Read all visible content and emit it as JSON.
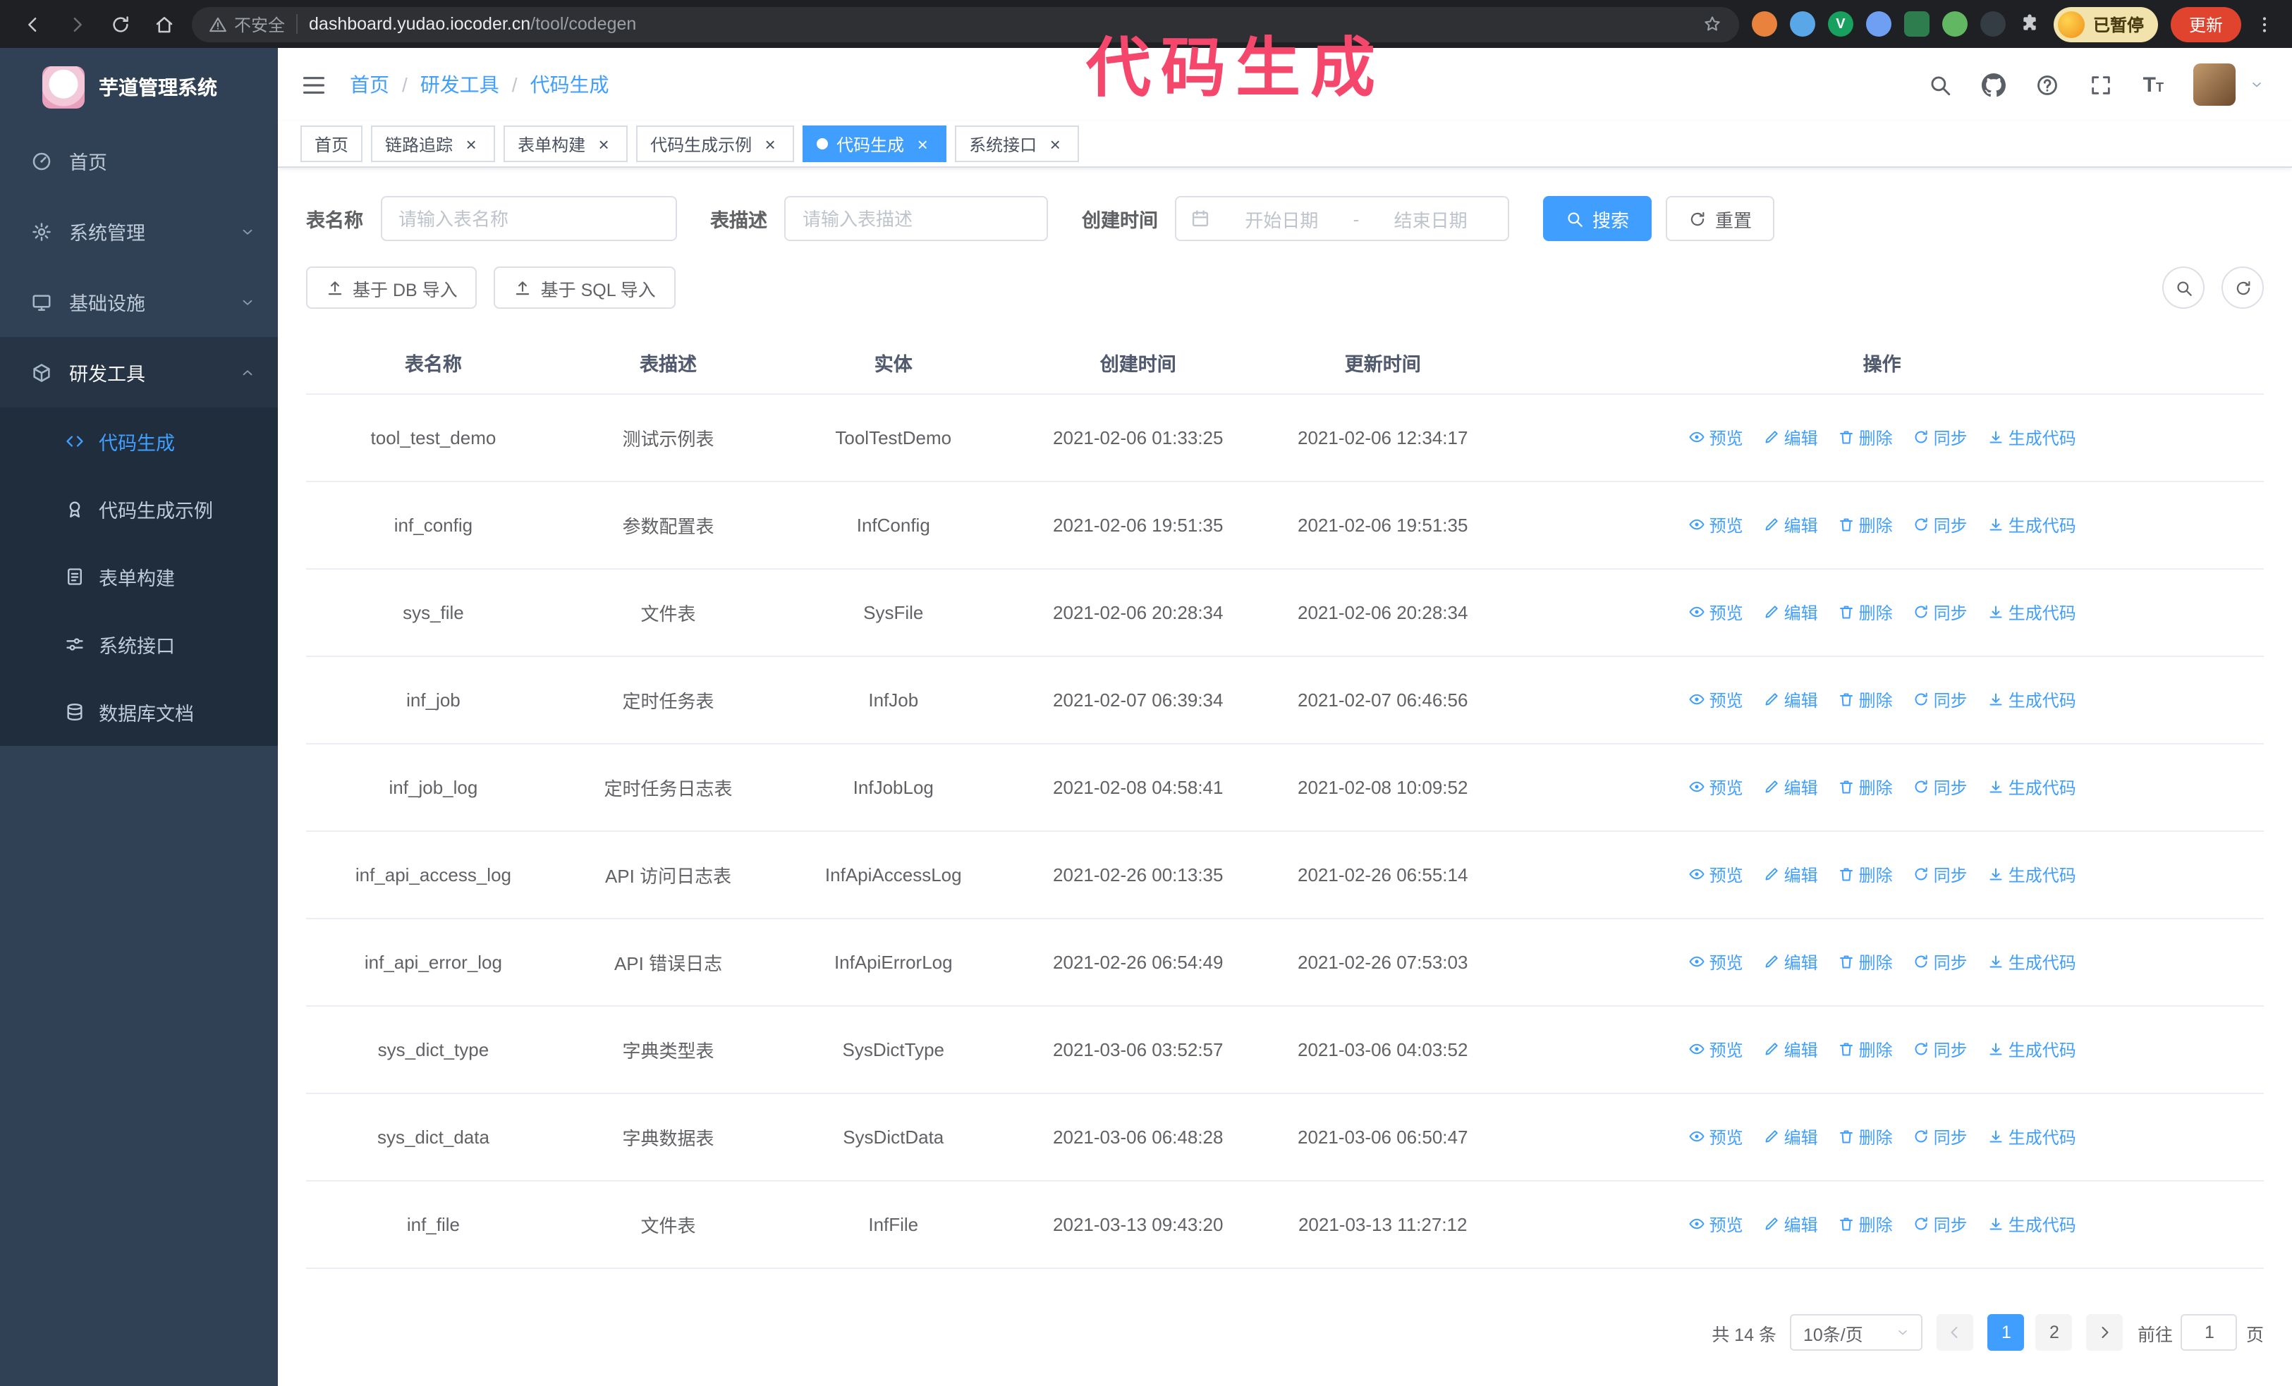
{
  "annotation": {
    "text": "代码生成",
    "color": "#f5476b"
  },
  "theme": {
    "primary": "#409eff",
    "sidebar_bg": "#304156",
    "submenu_bg": "#1f2d3d"
  },
  "browser": {
    "security_label": "不安全",
    "url_domain": "dashboard.yudao.iocoder.cn",
    "url_path": "/tool/codegen",
    "profile_badge": "已暂停",
    "update_button": "更新",
    "extensions": [
      {
        "name": "extension-icon-orange",
        "color": "#e8823c",
        "shape": "circle",
        "glyph": ""
      },
      {
        "name": "extension-icon-water-drop",
        "color": "#5aa7e8",
        "shape": "circle",
        "glyph": ""
      },
      {
        "name": "extension-icon-green-v",
        "color": "#17a05e",
        "shape": "circle",
        "glyph": "V"
      },
      {
        "name": "extension-icon-people",
        "color": "#6f9ff2",
        "shape": "circle",
        "glyph": ""
      },
      {
        "name": "extension-icon-dark-green",
        "color": "#2e7d4f",
        "shape": "square",
        "glyph": ""
      },
      {
        "name": "extension-icon-leaf",
        "color": "#62b862",
        "shape": "circle",
        "glyph": ""
      },
      {
        "name": "extension-icon-paw",
        "color": "#343c44",
        "shape": "circle",
        "glyph": ""
      }
    ]
  },
  "sidebar": {
    "logo_text": "芋道管理系统",
    "items": [
      {
        "id": "home",
        "label": "首页",
        "icon": "dashboard"
      },
      {
        "id": "system-mgmt",
        "label": "系统管理",
        "icon": "gear",
        "expandable": true
      },
      {
        "id": "infrastructure",
        "label": "基础设施",
        "icon": "infra",
        "expandable": true
      },
      {
        "id": "dev-tools",
        "label": "研发工具",
        "icon": "tools",
        "expandable": true,
        "expanded": true,
        "children": [
          {
            "id": "codegen",
            "label": "代码生成",
            "icon": "code",
            "active": true
          },
          {
            "id": "codegen-example",
            "label": "代码生成示例",
            "icon": "badge"
          },
          {
            "id": "form-builder",
            "label": "表单构建",
            "icon": "form"
          },
          {
            "id": "system-api",
            "label": "系统接口",
            "icon": "api"
          },
          {
            "id": "db-doc",
            "label": "数据库文档",
            "icon": "dbdoc"
          }
        ]
      }
    ]
  },
  "header": {
    "breadcrumb": [
      "首页",
      "研发工具",
      "代码生成"
    ]
  },
  "tabs": [
    {
      "id": "home",
      "label": "首页",
      "closable": false,
      "active": false
    },
    {
      "id": "trace",
      "label": "链路追踪",
      "closable": true,
      "active": false
    },
    {
      "id": "form-builder",
      "label": "表单构建",
      "closable": true,
      "active": false
    },
    {
      "id": "codegen-example",
      "label": "代码生成示例",
      "closable": true,
      "active": false
    },
    {
      "id": "codegen",
      "label": "代码生成",
      "closable": true,
      "active": true
    },
    {
      "id": "system-api",
      "label": "系统接口",
      "closable": true,
      "active": false
    }
  ],
  "filters": {
    "table_name_label": "表名称",
    "table_name_placeholder": "请输入表名称",
    "table_desc_label": "表描述",
    "table_desc_placeholder": "请输入表描述",
    "create_time_label": "创建时间",
    "date_start_placeholder": "开始日期",
    "date_separator": "-",
    "date_end_placeholder": "结束日期",
    "search_button": "搜索",
    "reset_button": "重置"
  },
  "toolbar": {
    "import_db": "基于 DB 导入",
    "import_sql": "基于 SQL 导入"
  },
  "table": {
    "columns": [
      "表名称",
      "表描述",
      "实体",
      "创建时间",
      "更新时间",
      "操作"
    ],
    "actions": [
      {
        "name": "preview",
        "label": "预览",
        "icon": "eye"
      },
      {
        "name": "edit",
        "label": "编辑",
        "icon": "pencil"
      },
      {
        "name": "delete",
        "label": "删除",
        "icon": "trash"
      },
      {
        "name": "sync",
        "label": "同步",
        "icon": "refresh"
      },
      {
        "name": "generate",
        "label": "生成代码",
        "icon": "download"
      }
    ],
    "rows": [
      {
        "name": "tool_test_demo",
        "desc": "测试示例表",
        "entity": "ToolTestDemo",
        "created": "2021-02-06 01:33:25",
        "updated": "2021-02-06 12:34:17"
      },
      {
        "name": "inf_config",
        "desc": "参数配置表",
        "entity": "InfConfig",
        "created": "2021-02-06 19:51:35",
        "updated": "2021-02-06 19:51:35"
      },
      {
        "name": "sys_file",
        "desc": "文件表",
        "entity": "SysFile",
        "created": "2021-02-06 20:28:34",
        "updated": "2021-02-06 20:28:34"
      },
      {
        "name": "inf_job",
        "desc": "定时任务表",
        "entity": "InfJob",
        "created": "2021-02-07 06:39:34",
        "updated": "2021-02-07 06:46:56"
      },
      {
        "name": "inf_job_log",
        "desc": "定时任务日志表",
        "entity": "InfJobLog",
        "created": "2021-02-08 04:58:41",
        "updated": "2021-02-08 10:09:52"
      },
      {
        "name": "inf_api_access_log",
        "desc": "API 访问日志表",
        "entity": "InfApiAccessLog",
        "created": "2021-02-26 00:13:35",
        "updated": "2021-02-26 06:55:14"
      },
      {
        "name": "inf_api_error_log",
        "desc": "API 错误日志",
        "entity": "InfApiErrorLog",
        "created": "2021-02-26 06:54:49",
        "updated": "2021-02-26 07:53:03"
      },
      {
        "name": "sys_dict_type",
        "desc": "字典类型表",
        "entity": "SysDictType",
        "created": "2021-03-06 03:52:57",
        "updated": "2021-03-06 04:03:52"
      },
      {
        "name": "sys_dict_data",
        "desc": "字典数据表",
        "entity": "SysDictData",
        "created": "2021-03-06 06:48:28",
        "updated": "2021-03-06 06:50:47"
      },
      {
        "name": "inf_file",
        "desc": "文件表",
        "entity": "InfFile",
        "created": "2021-03-13 09:43:20",
        "updated": "2021-03-13 11:27:12"
      }
    ]
  },
  "pagination": {
    "total_text": "共 14 条",
    "page_size": "10条/页",
    "pages": [
      "1",
      "2"
    ],
    "active_page": "1",
    "goto_prefix": "前往",
    "goto_value": "1",
    "goto_suffix": "页"
  }
}
